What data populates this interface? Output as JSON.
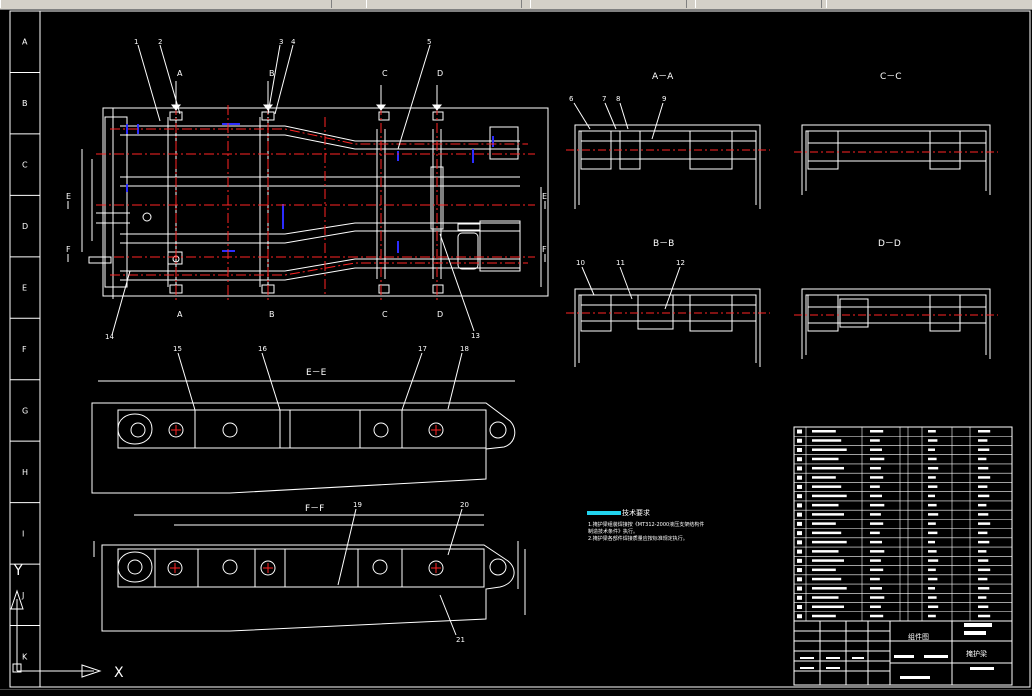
{
  "border": {
    "row_letters": [
      "A",
      "B",
      "C",
      "D",
      "E",
      "F",
      "G",
      "H",
      "I",
      "J",
      "K"
    ]
  },
  "views": {
    "plan": {
      "section_marks": [
        "A",
        "B",
        "C",
        "D"
      ],
      "cut_marks": [
        "E",
        "F"
      ],
      "part_numbers": {
        "p1": "1",
        "p2": "2",
        "p3": "3",
        "p4": "4",
        "p5": "5",
        "p13": "13",
        "p14": "14"
      }
    },
    "section_aa": {
      "title": "A－A",
      "labels": [
        "6",
        "7",
        "8",
        "9"
      ]
    },
    "section_cc": {
      "title": "C－C"
    },
    "section_bb": {
      "title": "B－B",
      "labels": [
        "10",
        "11",
        "12"
      ]
    },
    "section_dd": {
      "title": "D－D"
    },
    "section_ee": {
      "title": "E－E",
      "labels": [
        "15",
        "16",
        "17",
        "18"
      ]
    },
    "section_ff": {
      "title": "F－F",
      "labels": [
        "19",
        "20",
        "21"
      ]
    }
  },
  "notes": {
    "heading": "技术要求",
    "lines": [
      "1.掩护梁组装焊接按《MT312-2000液压支架结构件",
      "  制造技术条件》执行。",
      "2.掩护梁各部件焊接质量应按标准规定执行。"
    ]
  },
  "title_block": {
    "drawing_type": "组件图",
    "drawing_name": "掩护梁"
  },
  "ucs": {
    "x_label": "X",
    "y_label": "Y"
  },
  "colors": {
    "outline": "#ffffff",
    "centerline": "#ff2020",
    "hidden": "#3030ff",
    "dimension": "#ffffff",
    "accent": "#22d3ee"
  }
}
